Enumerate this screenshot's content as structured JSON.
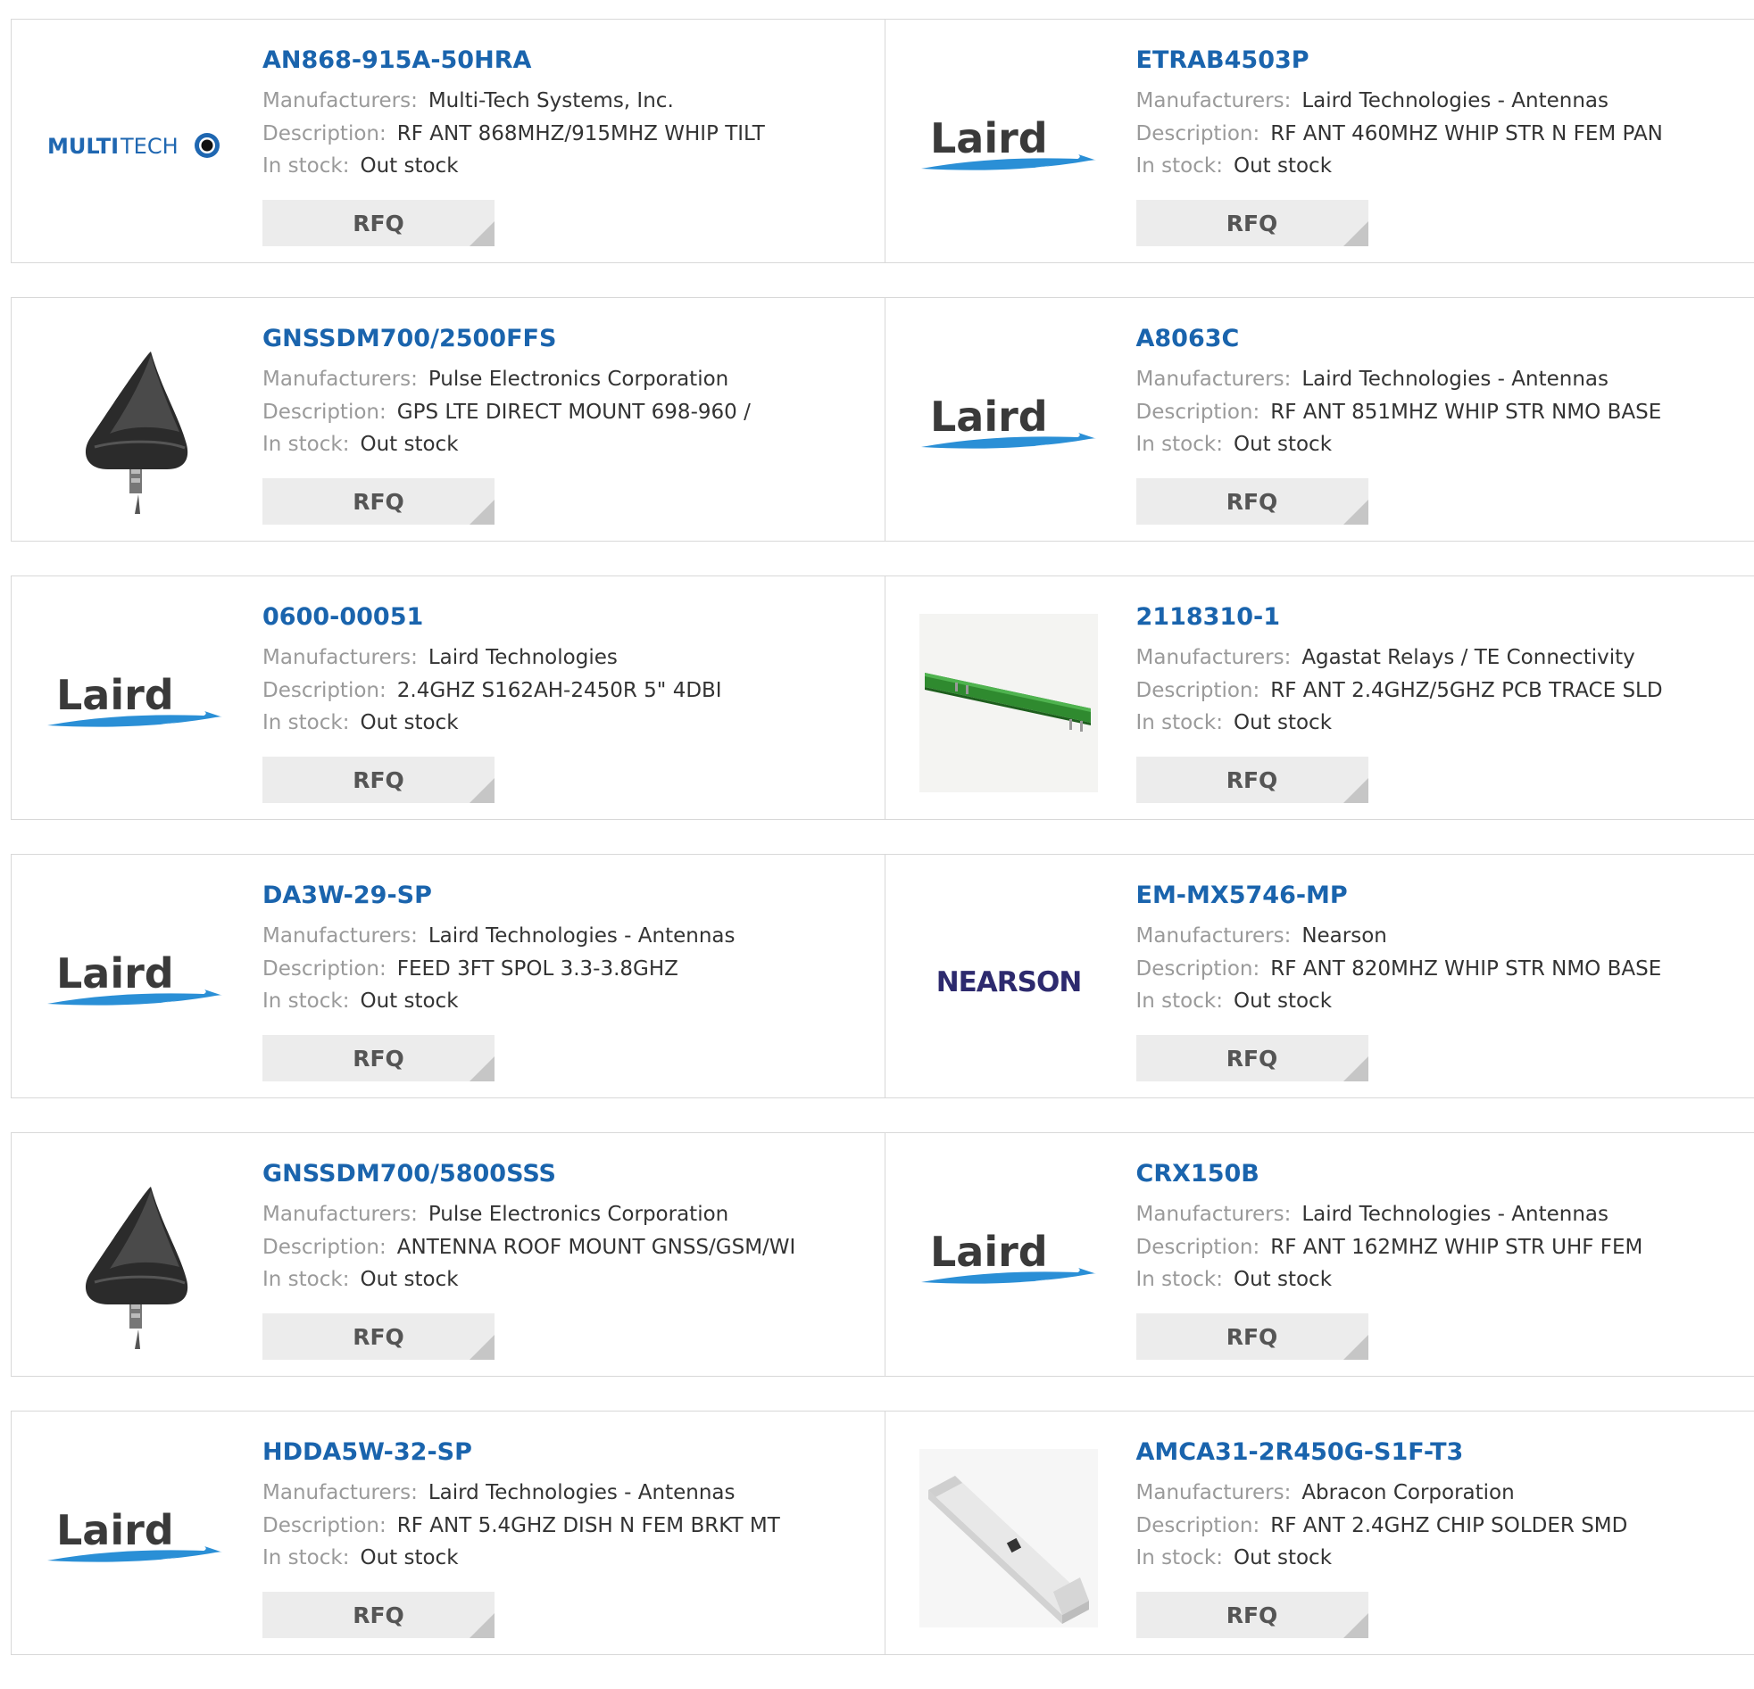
{
  "labels": {
    "manufacturers": "Manufacturers:",
    "description": "Description:",
    "in_stock": "In stock:",
    "rfq": "RFQ"
  },
  "brand_text": {
    "multitech_bold": "MULTI",
    "multitech_light": "TECH",
    "laird": "Laird",
    "nearson": "NEARSON"
  },
  "colors": {
    "title_blue": "#1a64ad",
    "label_gray": "#9a9a9a",
    "value_dark": "#333333",
    "button_bg": "#ececec",
    "border": "#d8d8d8"
  },
  "rows": [
    [
      {
        "part": "AN868-915A-50HRA",
        "manufacturer": "Multi-Tech Systems, Inc.",
        "description": "RF ANT 868MHZ/915MHZ WHIP TILT",
        "stock": "Out stock",
        "image": "multitech-logo"
      },
      {
        "part": "ETRAB4503P",
        "manufacturer": "Laird Technologies - Antennas",
        "description": "RF ANT 460MHZ WHIP STR N FEM PAN",
        "stock": "Out stock",
        "image": "laird-logo"
      }
    ],
    [
      {
        "part": "GNSSDM700/2500FFS",
        "manufacturer": "Pulse Electronics Corporation",
        "description": "GPS LTE DIRECT MOUNT 698-960 /",
        "stock": "Out stock",
        "image": "shark-fin-antenna"
      },
      {
        "part": "A8063C",
        "manufacturer": "Laird Technologies - Antennas",
        "description": "RF ANT 851MHZ WHIP STR NMO BASE",
        "stock": "Out stock",
        "image": "laird-logo"
      }
    ],
    [
      {
        "part": "0600-00051",
        "manufacturer": "Laird Technologies",
        "description": "2.4GHZ S162AH-2450R 5\" 4DBI",
        "stock": "Out stock",
        "image": "laird-logo"
      },
      {
        "part": "2118310-1",
        "manufacturer": "Agastat Relays / TE Connectivity",
        "description": "RF ANT 2.4GHZ/5GHZ PCB TRACE SLD",
        "stock": "Out stock",
        "image": "pcb-antenna"
      }
    ],
    [
      {
        "part": "DA3W-29-SP",
        "manufacturer": "Laird Technologies - Antennas",
        "description": "FEED 3FT SPOL 3.3-3.8GHZ",
        "stock": "Out stock",
        "image": "laird-logo"
      },
      {
        "part": "EM-MX5746-MP",
        "manufacturer": "Nearson",
        "description": "RF ANT 820MHZ WHIP STR NMO BASE",
        "stock": "Out stock",
        "image": "nearson-logo"
      }
    ],
    [
      {
        "part": "GNSSDM700/5800SSS",
        "manufacturer": "Pulse Electronics Corporation",
        "description": "ANTENNA ROOF MOUNT GNSS/GSM/WI",
        "stock": "Out stock",
        "image": "shark-fin-antenna"
      },
      {
        "part": "CRX150B",
        "manufacturer": "Laird Technologies - Antennas",
        "description": "RF ANT 162MHZ WHIP STR UHF FEM",
        "stock": "Out stock",
        "image": "laird-logo"
      }
    ],
    [
      {
        "part": "HDDA5W-32-SP",
        "manufacturer": "Laird Technologies - Antennas",
        "description": "RF ANT 5.4GHZ DISH N FEM BRKT MT",
        "stock": "Out stock",
        "image": "laird-logo"
      },
      {
        "part": "AMCA31-2R450G-S1F-T3",
        "manufacturer": "Abracon Corporation",
        "description": "RF ANT 2.4GHZ CHIP SOLDER SMD",
        "stock": "Out stock",
        "image": "chip-antenna"
      }
    ]
  ]
}
